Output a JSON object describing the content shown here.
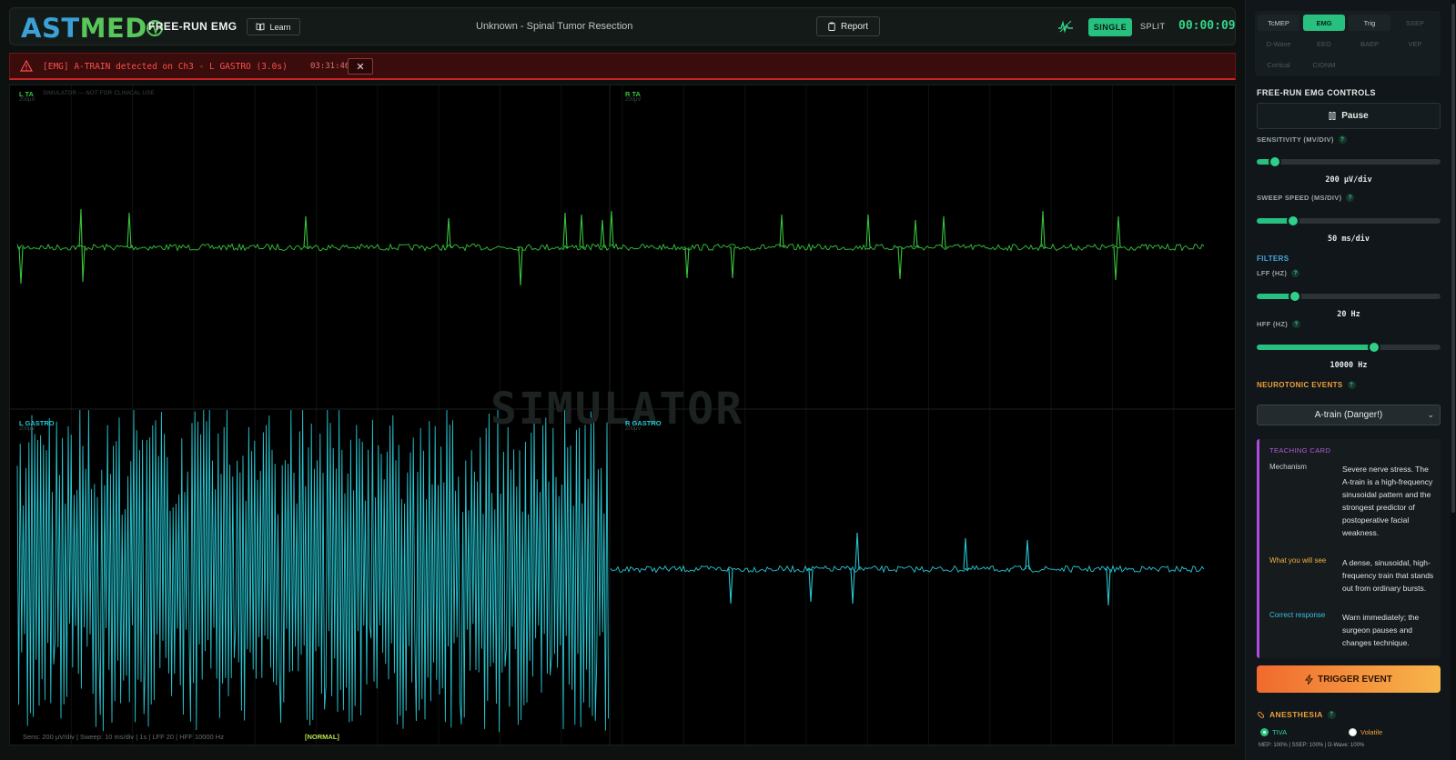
{
  "header": {
    "logo_part1": "AST",
    "logo_part2": "MED",
    "mode_title": "FREE-RUN EMG",
    "learn_label": "Learn",
    "case_title": "Unknown - Spinal Tumor Resection",
    "report_label": "Report",
    "single_label": "SINGLE",
    "split_label": "SPLIT",
    "timer": "00:00:09"
  },
  "alert": {
    "message": "[EMG] A-TRAIN detected on Ch3 - L GASTRO (3.0s)",
    "time": "03:31:46",
    "close_label": "✕"
  },
  "scope": {
    "sim_note": "SIMULATOR — NOT FOR CLINICAL USE",
    "watermark": "SIMULATOR",
    "status_line": "Sens: 200 μV/div | Sweep: 10 ms/div | 1s | LFF 20 | HFF 10000 Hz",
    "status_tag": "[NORMAL]",
    "channels": [
      {
        "label": "L TA",
        "scale": "200μV",
        "color": "#35c43a"
      },
      {
        "label": "R TA",
        "scale": "200μV",
        "color": "#35c43a"
      },
      {
        "label": "L GASTRO",
        "scale": "200μV",
        "color": "#27c6d2"
      },
      {
        "label": "R GASTRO",
        "scale": "200μV",
        "color": "#27c6d2"
      }
    ]
  },
  "sidebar": {
    "modalities": [
      "TcMEP",
      "EMG",
      "Trig",
      "SSEP",
      "D-Wave",
      "EEG",
      "BAEP",
      "VEP",
      "Cortical",
      "CIONM"
    ],
    "active_modality": "EMG",
    "controls_title": "FREE-RUN EMG CONTROLS",
    "pause_label": "Pause",
    "sensitivity": {
      "label": "SENSITIVITY (MV/DIV)",
      "value": "200 μV/div",
      "level": 0.1
    },
    "sweep": {
      "label": "SWEEP SPEED (MS/DIV)",
      "value": "50 ms/div",
      "level": 0.2
    },
    "filters_title": "FILTERS",
    "lff": {
      "label": "LFF (HZ)",
      "value": "20 Hz",
      "level": 0.21
    },
    "hff": {
      "label": "HFF (HZ)",
      "value": "10000 Hz",
      "level": 0.64
    },
    "neurotonic_title": "NEUROTONIC EVENTS",
    "event_selected": "A-train (Danger!)",
    "teaching_card": {
      "title": "TEACHING CARD",
      "rows": [
        {
          "key": "Mechanism",
          "key_color": "#c8d0cc",
          "value": "Severe nerve stress. The A-train is a high-frequency sinusoidal pattern and the strongest predictor of postoperative facial weakness."
        },
        {
          "key": "What you will see",
          "key_color": "#f0b23a",
          "value": "A dense, sinusoidal, high-frequency train that stands out from ordinary bursts."
        },
        {
          "key": "Correct response",
          "key_color": "#35c0e0",
          "value": "Warn immediately; the surgeon pauses and changes technique."
        }
      ]
    },
    "trigger_label": "TRIGGER EVENT",
    "anesthesia_title": "ANESTHESIA",
    "tiva_label": "TIVA",
    "volatile_label": "Volatile",
    "anesthesia_footer": "MEP: 100% | SSEP: 100% | D-Wave: 100%"
  }
}
